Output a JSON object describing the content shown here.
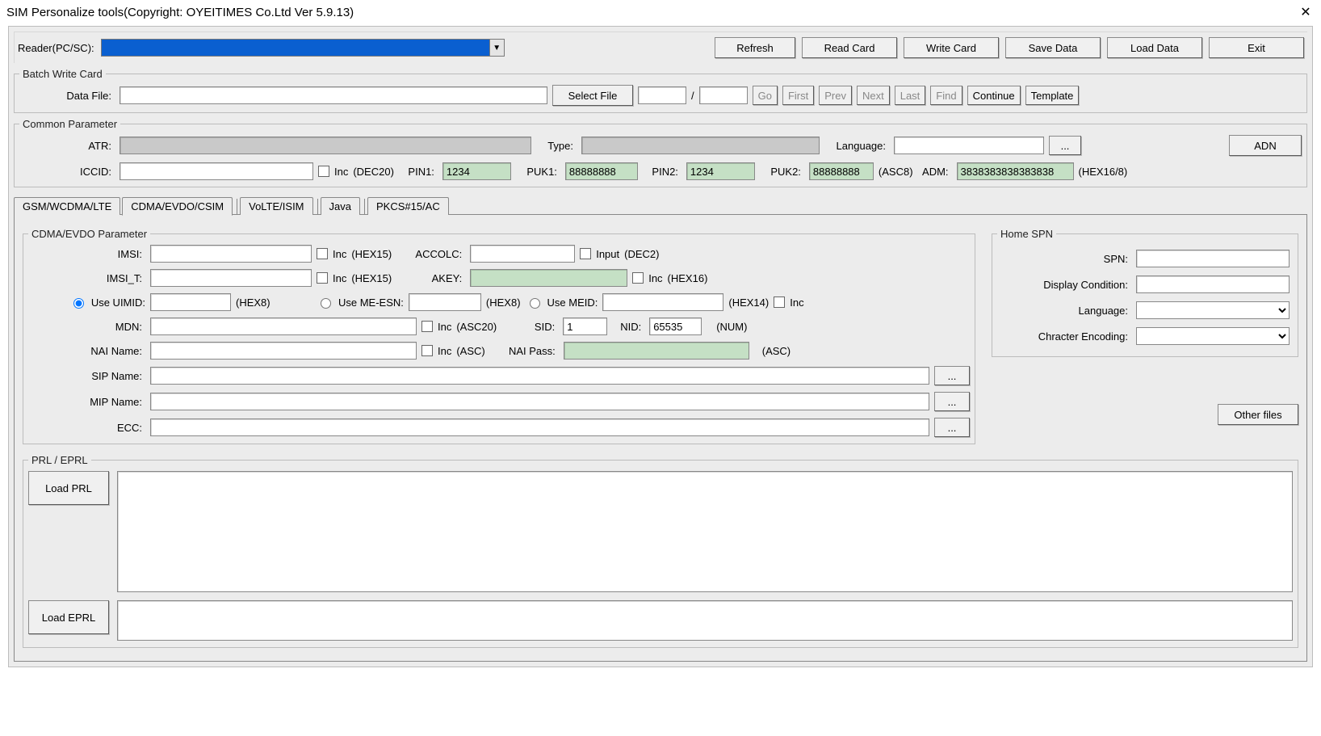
{
  "title": "SIM Personalize tools(Copyright: OYEITIMES Co.Ltd  Ver 5.9.13)",
  "topbar": {
    "reader_label": "Reader(PC/SC):",
    "reader_value": "",
    "buttons": {
      "refresh": "Refresh",
      "read_card": "Read Card",
      "write_card": "Write Card",
      "save_data": "Save Data",
      "load_data": "Load Data",
      "exit": "Exit"
    }
  },
  "batch": {
    "legend": "Batch Write Card",
    "data_file_label": "Data File:",
    "data_file_value": "",
    "select_file": "Select File",
    "index_a": "",
    "slash": "/",
    "index_b": "",
    "go": "Go",
    "first": "First",
    "prev": "Prev",
    "next": "Next",
    "last": "Last",
    "find": "Find",
    "continue": "Continue",
    "template": "Template"
  },
  "common": {
    "legend": "Common Parameter",
    "atr_label": "ATR:",
    "atr_value": "",
    "type_label": "Type:",
    "type_value": "",
    "language_label": "Language:",
    "language_value": "",
    "lang_browse": "...",
    "adn": "ADN",
    "iccid_label": "ICCID:",
    "iccid_value": "",
    "inc": "Inc",
    "dec20": "(DEC20)",
    "pin1_label": "PIN1:",
    "pin1_value": "1234",
    "puk1_label": "PUK1:",
    "puk1_value": "88888888",
    "pin2_label": "PIN2:",
    "pin2_value": "1234",
    "puk2_label": "PUK2:",
    "puk2_value": "88888888",
    "asc8": "(ASC8)",
    "adm_label": "ADM:",
    "adm_value": "3838383838383838",
    "hex16_8": "(HEX16/8)"
  },
  "tabs": {
    "t0": "GSM/WCDMA/LTE",
    "t1": "CDMA/EVDO/CSIM",
    "t2": "VoLTE/ISIM",
    "t3": "Java",
    "t4": "PKCS#15/AC"
  },
  "cdma": {
    "legend": "CDMA/EVDO Parameter",
    "imsi_label": "IMSI:",
    "imsi_value": "",
    "inc": "Inc",
    "hex15": "(HEX15)",
    "accolc_label": "ACCOLC:",
    "accolc_value": "",
    "input": "Input",
    "dec2": "(DEC2)",
    "imsit_label": "IMSI_T:",
    "imsit_value": "",
    "akey_label": "AKEY:",
    "akey_value": "",
    "hex16": "(HEX16)",
    "use_uimid": "Use UIMID:",
    "uimid_value": "",
    "hex8": "(HEX8)",
    "use_me_esn": "Use ME-ESN:",
    "me_esn_value": "",
    "use_meid": "Use MEID:",
    "meid_value": "",
    "hex14": "(HEX14)",
    "mdn_label": "MDN:",
    "mdn_value": "",
    "asc20": "(ASC20)",
    "sid_label": "SID:",
    "sid_value": "1",
    "nid_label": "NID:",
    "nid_value": "65535",
    "num": "(NUM)",
    "nai_name_label": "NAI Name:",
    "nai_name_value": "",
    "asc": "(ASC)",
    "nai_pass_label": "NAI Pass:",
    "nai_pass_value": "",
    "sip_name_label": "SIP Name:",
    "sip_name_value": "",
    "mip_name_label": "MIP Name:",
    "mip_name_value": "",
    "ecc_label": "ECC:",
    "ecc_value": "",
    "browse": "...",
    "other_files": "Other files"
  },
  "home_spn": {
    "legend": "Home SPN",
    "spn_label": "SPN:",
    "spn_value": "",
    "display_cond_label": "Display Condition:",
    "display_cond_value": "",
    "language_label": "Language:",
    "language_value": "",
    "char_enc_label": "Chracter Encoding:",
    "char_enc_value": ""
  },
  "prl": {
    "legend": "PRL / EPRL",
    "load_prl": "Load PRL",
    "load_eprl": "Load EPRL",
    "prl_text": "",
    "eprl_text": ""
  }
}
